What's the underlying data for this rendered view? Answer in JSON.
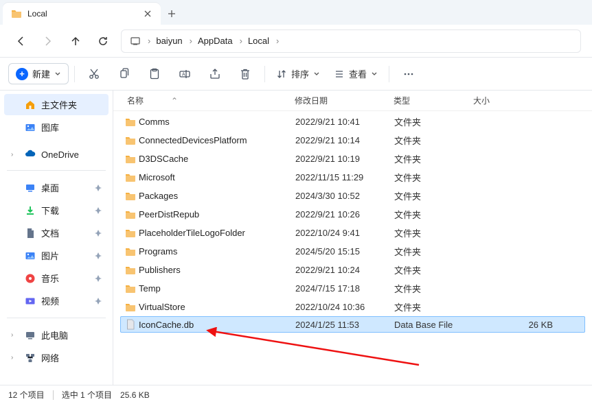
{
  "window": {
    "tab_title": "Local"
  },
  "breadcrumbs": {
    "items": [
      "baiyun",
      "AppData",
      "Local"
    ]
  },
  "toolbar": {
    "new_label": "新建",
    "sort_label": "排序",
    "view_label": "查看"
  },
  "columns": {
    "name": "名称",
    "date": "修改日期",
    "type": "类型",
    "size": "大小"
  },
  "sidebar": {
    "home": "主文件夹",
    "gallery": "图库",
    "onedrive": "OneDrive",
    "desktop": "桌面",
    "downloads": "下载",
    "documents": "文档",
    "pictures": "图片",
    "music": "音乐",
    "videos": "视频",
    "thispc": "此电脑",
    "network": "网络"
  },
  "files": [
    {
      "name": "Comms",
      "date": "2022/9/21 10:41",
      "type": "文件夹",
      "size": "",
      "kind": "folder"
    },
    {
      "name": "ConnectedDevicesPlatform",
      "date": "2022/9/21 10:14",
      "type": "文件夹",
      "size": "",
      "kind": "folder"
    },
    {
      "name": "D3DSCache",
      "date": "2022/9/21 10:19",
      "type": "文件夹",
      "size": "",
      "kind": "folder"
    },
    {
      "name": "Microsoft",
      "date": "2022/11/15 11:29",
      "type": "文件夹",
      "size": "",
      "kind": "folder"
    },
    {
      "name": "Packages",
      "date": "2024/3/30 10:52",
      "type": "文件夹",
      "size": "",
      "kind": "folder"
    },
    {
      "name": "PeerDistRepub",
      "date": "2022/9/21 10:26",
      "type": "文件夹",
      "size": "",
      "kind": "folder"
    },
    {
      "name": "PlaceholderTileLogoFolder",
      "date": "2022/10/24 9:41",
      "type": "文件夹",
      "size": "",
      "kind": "folder"
    },
    {
      "name": "Programs",
      "date": "2024/5/20 15:15",
      "type": "文件夹",
      "size": "",
      "kind": "folder"
    },
    {
      "name": "Publishers",
      "date": "2022/9/21 10:24",
      "type": "文件夹",
      "size": "",
      "kind": "folder"
    },
    {
      "name": "Temp",
      "date": "2024/7/15 17:18",
      "type": "文件夹",
      "size": "",
      "kind": "folder"
    },
    {
      "name": "VirtualStore",
      "date": "2022/10/24 10:36",
      "type": "文件夹",
      "size": "",
      "kind": "folder"
    },
    {
      "name": "IconCache.db",
      "date": "2024/1/25 11:53",
      "type": "Data Base File",
      "size": "26 KB",
      "kind": "db",
      "selected": true
    }
  ],
  "status": {
    "count": "12 个项目",
    "selected": "选中 1 个项目",
    "sel_size": "25.6 KB"
  }
}
